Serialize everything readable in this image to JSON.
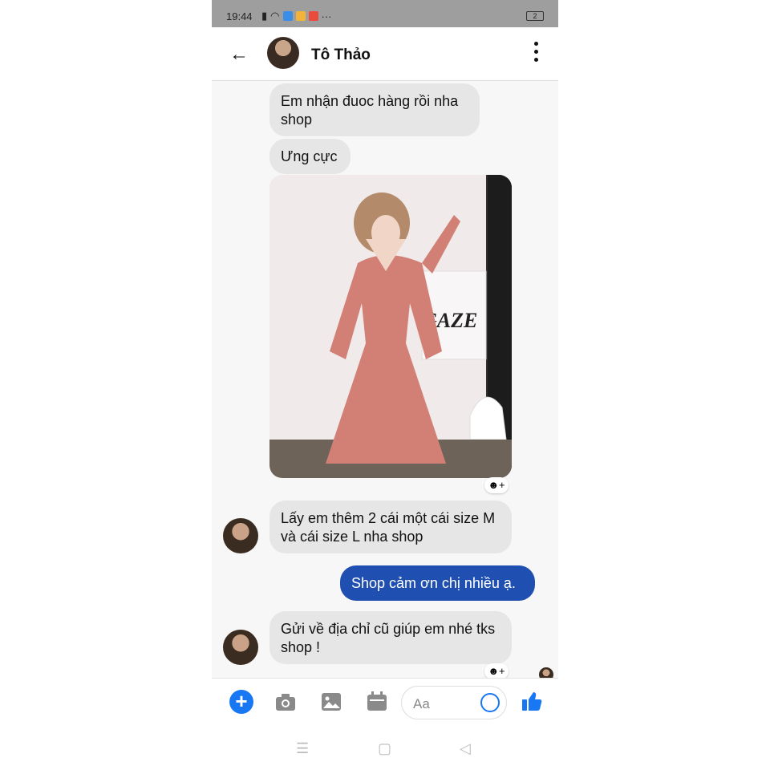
{
  "status_bar": {
    "time": "19:44",
    "battery": "2"
  },
  "header": {
    "contact_name": "Tô Thảo"
  },
  "messages": {
    "m1": "Em nhận đuoc hàng rồi nha shop",
    "m2": "Ưng cực",
    "m3": "Lấy em thêm 2 cái một cái size M và cái size L nha shop",
    "m4": "Shop cảm ơn chị nhiều ạ.",
    "m5": "Gửi về địa chỉ cũ giúp em nhé tks shop !"
  },
  "photo_text": "GAZE",
  "composer": {
    "placeholder": "Aa"
  },
  "colors": {
    "outgoing": "#1f4fb0",
    "incoming": "#e6e6e6",
    "accent": "#1877f2"
  }
}
